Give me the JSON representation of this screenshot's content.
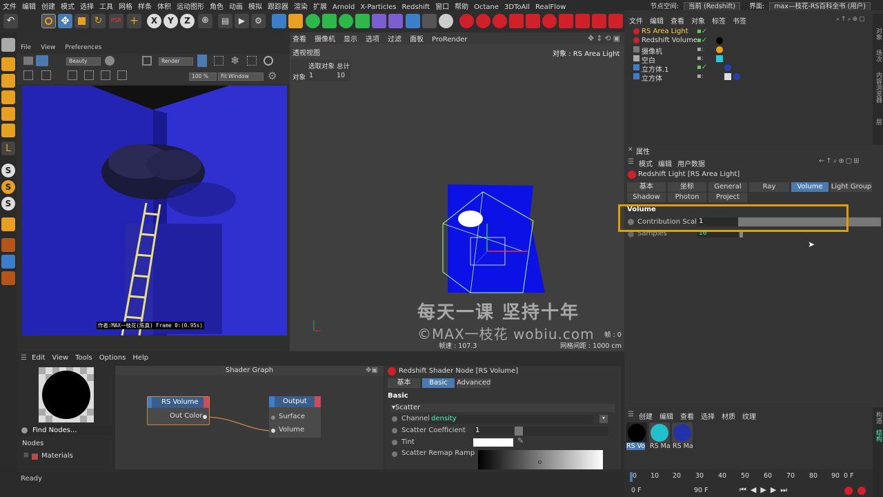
{
  "menubar": {
    "items": [
      "文件",
      "编辑",
      "创建",
      "模式",
      "选择",
      "工具",
      "网格",
      "样条",
      "体积",
      "运动图形",
      "角色",
      "动画",
      "模拟",
      "跟踪器",
      "渲染",
      "扩展",
      "Arnold",
      "X-Particles",
      "Redshift",
      "窗口",
      "帮助",
      "Octane",
      "3DToAll",
      "RealFlow"
    ],
    "node_space_label": "节点空间:",
    "node_space_value": "当前 (Redshift)",
    "layout_label": "界面:",
    "layout_value": "max—枝花-RS百科全书 (用户)"
  },
  "ir": {
    "menu": [
      "File",
      "View",
      "Preferences"
    ],
    "aov": "Beauty",
    "render_dd": "Render",
    "zoom": "100 %",
    "fit": "Fit Window",
    "caption": "作者:MAX一枝花(陈真)  Frame  0:(0.95s)"
  },
  "viewport": {
    "menu": [
      "查看",
      "摄像机",
      "显示",
      "选项",
      "过滤",
      "面板",
      "ProRender"
    ],
    "title": "透视视图",
    "object_label": "对象 : RS Area Light",
    "stats_header": "选取对象 总计",
    "stats_row_label": "对象",
    "stats_sel": "1",
    "stats_total": "10",
    "watermark1": "每天一课 坚持十年",
    "watermark2": "©MAX一枝花 wobiu.com",
    "fps": "帧速 : 107.3",
    "grid": "网格间距 : 1000 cm",
    "zero": "帧 : 0"
  },
  "objects": {
    "menu": [
      "文件",
      "编辑",
      "查看",
      "对象",
      "标签",
      "书签"
    ],
    "rows": [
      "RS Area Light",
      "Redshift Volume",
      "摄像机",
      "空白",
      "立方体.1",
      "立方体"
    ]
  },
  "side_tabs": [
    "对象",
    "场次",
    "内容浏览器",
    "层",
    "构造",
    "结构"
  ],
  "attributes": {
    "title": "属性",
    "menu": [
      "模式",
      "编辑",
      "用户数据"
    ],
    "node": "Redshift Light [RS Area Light]",
    "tabs_row1": [
      "基本",
      "坐标",
      "General",
      "Ray",
      "Volume",
      "Light Group"
    ],
    "tabs_row2": [
      "Shadow",
      "Photon",
      "Project"
    ],
    "active_tab": "Volume",
    "section": "Volume",
    "contribution_label": "Contribution Scale",
    "contribution_value": "1",
    "samples_label": "Samples",
    "samples_value": "16"
  },
  "materials": {
    "menu": [
      "创建",
      "编辑",
      "查看",
      "选择",
      "材质",
      "纹理"
    ],
    "items": [
      "RS Vo",
      "RS Ma",
      "RS Ma"
    ]
  },
  "timeline": {
    "ticks": [
      "0",
      "10",
      "20",
      "30",
      "40",
      "50",
      "60",
      "70",
      "80",
      "90"
    ],
    "current": "0 F",
    "start": "0 F",
    "end": "90 F"
  },
  "shader_graph": {
    "menu": [
      "Edit",
      "View",
      "Tools",
      "Options",
      "Help"
    ],
    "title": "Shader Graph",
    "find_nodes": "Find Nodes...",
    "nodes_label": "Nodes",
    "materials_label": "Materials",
    "node1_title": "RS Volume",
    "node1_port": "Out Color",
    "node2_title": "Output",
    "node2_port1": "Surface",
    "node2_port2": "Volume"
  },
  "node_settings": {
    "title": "Redshift Shader Node [RS Volume]",
    "tabs": [
      "基本",
      "Basic",
      "Advanced"
    ],
    "active_tab": "Basic",
    "section": "Basic",
    "group": "▾Scatter",
    "channel_label": "Channel",
    "channel_value": "density",
    "coef_label": "Scatter Coefficient",
    "coef_value": "1",
    "tint_label": "Tint",
    "remap_label": "Scatter Remap Ramp"
  },
  "status": "Ready",
  "colors": {
    "accent_blue": "#4a7bb0",
    "highlight": "#e0a000",
    "render_blue": "#2828c0"
  }
}
